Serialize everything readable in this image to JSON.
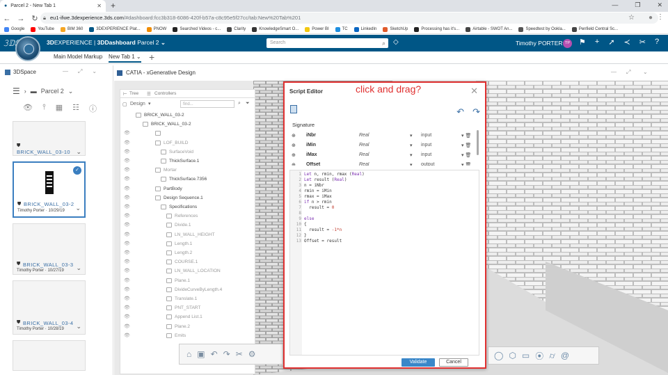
{
  "browser": {
    "tab_title": "Parcel 2 - New Tab 1",
    "url_host": "eu1-ifwe.3dexperience.3ds.com",
    "url_path": "/#dashboard:fcc3b318-6086-420f-b57a-c8c95e5f27cc/tab:New%20Tab%201",
    "bookmarks": [
      "Google",
      "YouTube",
      "BIM 360",
      "3DEXPERIENCE Plat...",
      "PNOW",
      "Searched Videos - c...",
      "Clarity",
      "KnowledgeSmart O...",
      "Power BI",
      "TC",
      "LinkedIn",
      "SketchUp",
      "Processing has it's...",
      "Airtable - SWOT An...",
      "Speedtest by Ookla...",
      "Penfield Central Sc..."
    ],
    "bookmark_colors": [
      "#4285f4",
      "#ff0000",
      "#f5a623",
      "#005686",
      "#f08c00",
      "#222222",
      "#444444",
      "#333333",
      "#f2c811",
      "#1f8fe0",
      "#0a66c2",
      "#e05a2b",
      "#222222",
      "#444444",
      "#555555",
      "#444444"
    ]
  },
  "app": {
    "brand_bold": "3D",
    "brand_rest": "EXPERIENCE | ",
    "brand_app": "3DDashboard",
    "brand_doc": "Parcel 2",
    "search_placeholder": "Search",
    "user_name": "Timothy PORTER",
    "user_initials": "TP",
    "accent_color": "#005686"
  },
  "dashboard_tabs": [
    "Main Model Markup",
    "New Tab 1"
  ],
  "space": {
    "title": "3DSpace",
    "breadcrumb": "Parcel 2",
    "cards": [
      {
        "name": "BRICK_WALL_03-10",
        "meta": ""
      },
      {
        "name": "BRICK_WALL_03-2",
        "meta": "Timothy Porter  ·  10/29/19"
      },
      {
        "name": "BRICK_WALL_03-3",
        "meta": "Timothy Porter  ·  10/27/19"
      },
      {
        "name": "BRICK_WALL_03-4",
        "meta": "Timothy Porter  ·  10/28/19"
      }
    ]
  },
  "catia": {
    "title": "CATIA - xGenerative Design",
    "tree_tabs": [
      "Tree",
      "Controllers"
    ],
    "tree_filter_label": "Design",
    "tree_find_placeholder": "find...",
    "tree_rows": [
      {
        "label": "BRICK_WALL_03-2",
        "active": true
      },
      {
        "label": "BRICK_WALL_03-2",
        "active": true
      },
      {
        "label": "",
        "active": false
      },
      {
        "label": "LOF_BUILD",
        "active": false
      },
      {
        "label": "SurfaceVoid",
        "active": false
      },
      {
        "label": "ThickSurface.1",
        "active": true
      },
      {
        "label": "Mortar",
        "active": false
      },
      {
        "label": "ThickSurface.7356",
        "active": true
      },
      {
        "label": "PartBody",
        "active": true
      },
      {
        "label": "Design Sequence.1",
        "active": true
      },
      {
        "label": "Specifications",
        "active": true
      },
      {
        "label": "References",
        "active": false
      },
      {
        "label": "Divide.1",
        "active": false
      },
      {
        "label": "LN_WALL_HEIGHT",
        "active": false
      },
      {
        "label": "Length.1",
        "active": false
      },
      {
        "label": "Length.2",
        "active": false
      },
      {
        "label": "COURSE.1",
        "active": false
      },
      {
        "label": "LN_WALL_LOCATION",
        "active": false
      },
      {
        "label": "Plane.1",
        "active": false
      },
      {
        "label": "DivideCurveByLength.4",
        "active": false
      },
      {
        "label": "Translate.1",
        "active": false
      },
      {
        "label": "PNT_START",
        "active": false
      },
      {
        "label": "Append List.1",
        "active": false
      },
      {
        "label": "Plane.2",
        "active": false
      },
      {
        "label": "Emits",
        "active": false
      }
    ]
  },
  "editor": {
    "title": "Script Editor",
    "annotation": "click and drag?",
    "signature_label": "Signature",
    "signature": [
      {
        "name": "iNbr",
        "type": "Real",
        "io": "input"
      },
      {
        "name": "iMin",
        "type": "Real",
        "io": "input"
      },
      {
        "name": "iMax",
        "type": "Real",
        "io": "input"
      },
      {
        "name": "Offset",
        "type": "Real",
        "io": "output"
      }
    ],
    "code": [
      "Let n, rmin, rmax (Real)",
      "Let result (Real)",
      "n = iNbr",
      "rmin = iMin",
      "rmax = iMax",
      "if n > rmin",
      "  result = 0",
      "",
      "else",
      "{",
      "  result = -1*n",
      "}",
      "Offset = result"
    ],
    "validate_label": "Validate",
    "cancel_label": "Cancel"
  }
}
